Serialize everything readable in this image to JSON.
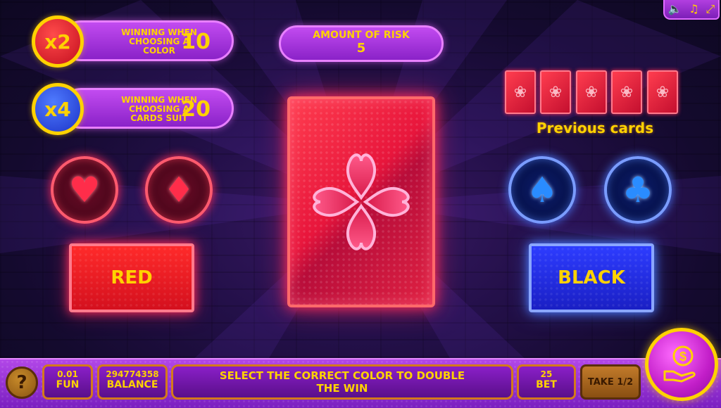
{
  "toolbar": {
    "sound_icon": "speaker-icon",
    "music_icon": "music-note-icon",
    "fullscreen_icon": "fullscreen-icon"
  },
  "multipliers": [
    {
      "badge": "x2",
      "label": "WINNING WHEN CHOOSING A COLOR",
      "value": "10",
      "color": "#d61a2a"
    },
    {
      "badge": "x4",
      "label": "WINNING WHEN CHOOSING A CARDS SUIT",
      "value": "20",
      "color": "#2b45e0"
    }
  ],
  "risk": {
    "title": "AMOUNT OF RISK",
    "value": "5"
  },
  "previous": {
    "title": "Previous cards",
    "count": 5
  },
  "buttons": {
    "red": "RED",
    "black": "BLACK"
  },
  "bottom": {
    "help": "?",
    "fun_value": "0.01",
    "fun_label": "FUN",
    "balance_value": "294774358",
    "balance_label": "BALANCE",
    "message": "SELECT THE CORRECT COLOR TO DOUBLE THE WIN",
    "bet_value": "25",
    "bet_label": "BET",
    "take": "TAKE 1/2"
  },
  "colors": {
    "accent": "#ffd200",
    "red": "#ff2c5a",
    "blue": "#4a7cff",
    "purple": "#b247e8"
  }
}
